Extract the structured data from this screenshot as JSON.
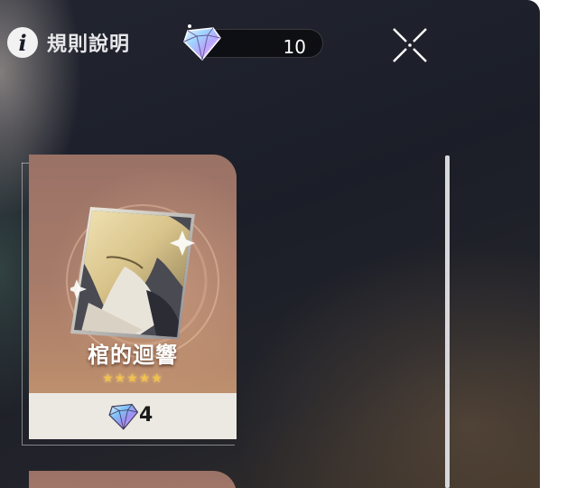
{
  "header": {
    "info_label": "規則說明",
    "currency_count": "10"
  },
  "cards": [
    {
      "title": "棺的迴響",
      "stars": "★★★★★",
      "star_count": 5,
      "price": "4"
    }
  ],
  "colors": {
    "background": "#1b1e28",
    "card_top": "#9a7266",
    "card_bottom": "#c79c74",
    "price_bar": "#ece8e2",
    "star": "#f2c14e"
  },
  "icons": {
    "info": "info-icon",
    "currency": "crystal-gem-icon",
    "close": "close-icon"
  }
}
